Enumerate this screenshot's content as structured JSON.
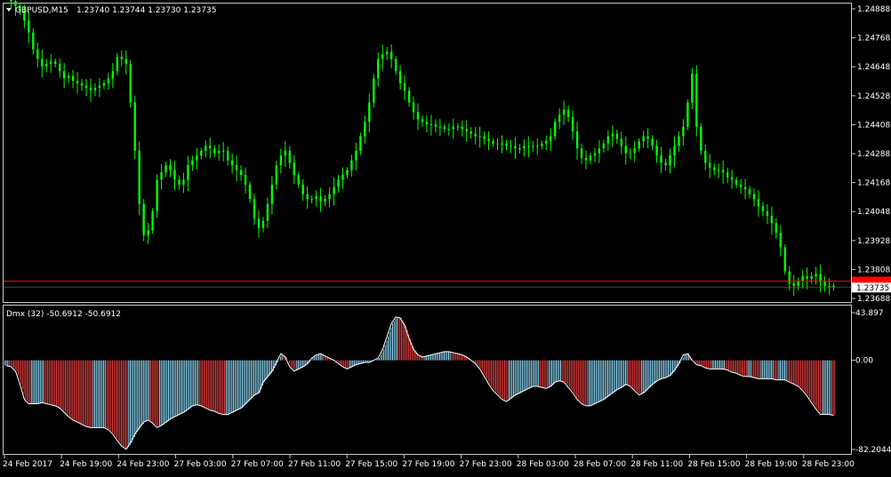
{
  "header": {
    "symbol": "GBPUSD,M15",
    "ohlc": "1.23740 1.23744 1.23730 1.23735"
  },
  "indicator": {
    "label": "Dmx (32) -50.6912 -50.6912",
    "axis_ticks": [
      "43.897",
      "0.00",
      "-82.2044"
    ]
  },
  "price_axis": {
    "ticks": [
      "1.24888",
      "1.24768",
      "1.24648",
      "1.24528",
      "1.24408",
      "1.24288",
      "1.24168",
      "1.24048",
      "1.23928",
      "1.23808",
      "1.23688"
    ],
    "current_price": "1.23735"
  },
  "time_axis": {
    "ticks": [
      "24 Feb 2017",
      "24 Feb 19:00",
      "24 Feb 23:00",
      "27 Feb 03:00",
      "27 Feb 07:00",
      "27 Feb 11:00",
      "27 Feb 15:00",
      "27 Feb 19:00",
      "27 Feb 23:00",
      "28 Feb 03:00",
      "28 Feb 07:00",
      "28 Feb 11:00",
      "28 Feb 15:00",
      "28 Feb 19:00",
      "28 Feb 23:00"
    ]
  },
  "colors": {
    "background": "#000000",
    "candle": "#00ff00",
    "axis": "#c8c8c8",
    "text": "#ffffff",
    "bid_line": "#ff0000",
    "dmx_up": "#87ceeb",
    "dmx_down": "#dc3c3c",
    "dmx_line": "#ffffff"
  },
  "chart_data": [
    {
      "type": "line",
      "name": "GBPUSD,M15",
      "x_labels": [
        "24 Feb 2017",
        "24 Feb 19:00",
        "24 Feb 23:00",
        "27 Feb 03:00",
        "27 Feb 07:00",
        "27 Feb 11:00",
        "27 Feb 15:00",
        "27 Feb 19:00",
        "27 Feb 23:00",
        "28 Feb 03:00",
        "28 Feb 07:00",
        "28 Feb 11:00",
        "28 Feb 15:00",
        "28 Feb 19:00",
        "28 Feb 23:00"
      ],
      "close_approx": [
        1.2495,
        1.2492,
        1.249,
        1.2488,
        1.2484,
        1.2479,
        1.2472,
        1.2468,
        1.2465,
        1.2466,
        1.2467,
        1.2466,
        1.2463,
        1.246,
        1.2461,
        1.2459,
        1.2458,
        1.2457,
        1.2456,
        1.2455,
        1.2456,
        1.2457,
        1.2458,
        1.246,
        1.2463,
        1.2469,
        1.2468,
        1.2466,
        1.245,
        1.243,
        1.2408,
        1.2395,
        1.2397,
        1.2405,
        1.2418,
        1.2421,
        1.2424,
        1.2422,
        1.2418,
        1.2416,
        1.2418,
        1.2424,
        1.2426,
        1.2428,
        1.243,
        1.2432,
        1.2431,
        1.2429,
        1.243,
        1.243,
        1.2426,
        1.2424,
        1.2422,
        1.242,
        1.2416,
        1.241,
        1.2402,
        1.2398,
        1.2401,
        1.2408,
        1.2416,
        1.2424,
        1.2428,
        1.243,
        1.2425,
        1.242,
        1.2416,
        1.2412,
        1.241,
        1.241,
        1.2411,
        1.2409,
        1.241,
        1.2412,
        1.2415,
        1.2418,
        1.242,
        1.2422,
        1.2426,
        1.243,
        1.2436,
        1.2442,
        1.245,
        1.246,
        1.2468,
        1.247,
        1.2471,
        1.2468,
        1.2463,
        1.2458,
        1.2455,
        1.245,
        1.2446,
        1.2443,
        1.2442,
        1.2441,
        1.2441,
        1.244,
        1.244,
        1.2439,
        1.2439,
        1.244,
        1.244,
        1.2439,
        1.2438,
        1.2437,
        1.2436,
        1.2436,
        1.2435,
        1.2434,
        1.2433,
        1.2433,
        1.2433,
        1.2432,
        1.2432,
        1.2431,
        1.2431,
        1.2432,
        1.2432,
        1.2432,
        1.2432,
        1.2433,
        1.2434,
        1.2436,
        1.2442,
        1.2445,
        1.2447,
        1.2444,
        1.2438,
        1.2431,
        1.2427,
        1.2426,
        1.2428,
        1.2429,
        1.2431,
        1.2433,
        1.2436,
        1.2437,
        1.2435,
        1.2432,
        1.2429,
        1.2429,
        1.2431,
        1.2434,
        1.2436,
        1.2435,
        1.2432,
        1.2428,
        1.2425,
        1.2424,
        1.2428,
        1.2432,
        1.2436,
        1.244,
        1.245,
        1.2462,
        1.244,
        1.243,
        1.2425,
        1.2423,
        1.2422,
        1.2422,
        1.2421,
        1.2419,
        1.2418,
        1.2416,
        1.2415,
        1.2414,
        1.2412,
        1.241,
        1.2407,
        1.2405,
        1.2403,
        1.24,
        1.2396,
        1.239,
        1.238,
        1.2375,
        1.2374,
        1.2376,
        1.2378,
        1.2377,
        1.2378,
        1.2379,
        1.2376,
        1.2374,
        1.2374,
        1.23735
      ],
      "ylim": [
        1.23688,
        1.24888
      ],
      "bid": 1.2376,
      "current": 1.23735
    },
    {
      "type": "area",
      "name": "Dmx (32)",
      "values": [
        -5,
        -6,
        -10,
        -22,
        -36,
        -40,
        -40,
        -40,
        -39,
        -40,
        -41,
        -42,
        -44,
        -48,
        -52,
        -55,
        -57,
        -59,
        -61,
        -62,
        -62,
        -62,
        -62,
        -64,
        -68,
        -74,
        -79,
        -82,
        -76,
        -68,
        -62,
        -57,
        -55,
        -58,
        -62,
        -60,
        -57,
        -54,
        -52,
        -50,
        -48,
        -45,
        -42,
        -41,
        -42,
        -44,
        -46,
        -47,
        -49,
        -50,
        -50,
        -48,
        -46,
        -44,
        -40,
        -36,
        -32,
        -30,
        -20,
        -15,
        -10,
        -2,
        6,
        3,
        -6,
        -10,
        -8,
        -6,
        -3,
        2,
        5,
        6,
        4,
        2,
        0,
        -3,
        -6,
        -8,
        -6,
        -4,
        -3,
        -2,
        -2,
        0,
        2,
        10,
        22,
        34,
        40,
        39,
        32,
        20,
        10,
        5,
        3,
        4,
        5,
        6,
        7,
        8,
        8,
        7,
        6,
        5,
        3,
        0,
        -3,
        -8,
        -15,
        -22,
        -28,
        -32,
        -36,
        -38,
        -35,
        -32,
        -30,
        -28,
        -26,
        -24,
        -24,
        -25,
        -26,
        -24,
        -20,
        -19,
        -20,
        -25,
        -30,
        -36,
        -40,
        -42,
        -42,
        -40,
        -38,
        -36,
        -33,
        -30,
        -27,
        -25,
        -22,
        -24,
        -28,
        -32,
        -30,
        -26,
        -22,
        -19,
        -17,
        -16,
        -14,
        -9,
        -3,
        5,
        6,
        0,
        -4,
        -5,
        -7,
        -8,
        -8,
        -8,
        -8,
        -9,
        -11,
        -12,
        -14,
        -15,
        -15,
        -16,
        -17,
        -17,
        -17,
        -17,
        -18,
        -18,
        -18,
        -20,
        -22,
        -24,
        -28,
        -33,
        -39,
        -45,
        -50,
        -50,
        -50,
        -50.69
      ],
      "ylim": [
        -82.2044,
        43.897
      ]
    }
  ]
}
